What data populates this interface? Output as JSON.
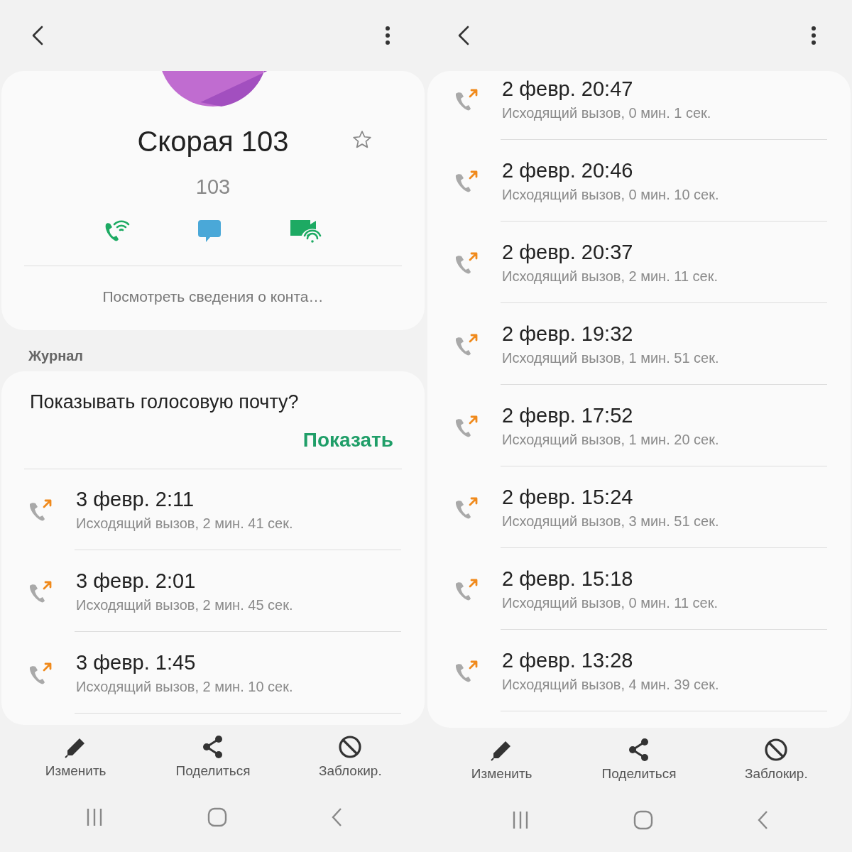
{
  "screens": [
    {
      "kind": "contact",
      "contact": {
        "name": "Скорая 103",
        "number": "103",
        "favorite": false,
        "quick_actions": [
          {
            "kind": "wifi-call"
          },
          {
            "kind": "message"
          },
          {
            "kind": "video-call"
          }
        ],
        "details_link": "Посмотреть сведения о конта…"
      },
      "section_label": "Журнал",
      "voicemail": {
        "question": "Показывать голосовую почту?",
        "button": "Показать"
      },
      "calls": [
        {
          "date": "3 февр. 2:11",
          "detail": "Исходящий вызов, 2 мин. 41 сек."
        },
        {
          "date": "3 февр. 2:01",
          "detail": "Исходящий вызов, 2 мин. 45 сек."
        },
        {
          "date": "3 февр. 1:45",
          "detail": "Исходящий вызов, 2 мин. 10 сек."
        }
      ],
      "actions": [
        {
          "kind": "edit",
          "label": "Изменить"
        },
        {
          "kind": "share",
          "label": "Поделиться"
        },
        {
          "kind": "block",
          "label": "Заблокир."
        }
      ]
    },
    {
      "kind": "history",
      "calls": [
        {
          "date": "2 февр. 20:47",
          "detail": "Исходящий вызов, 0 мин. 1 сек."
        },
        {
          "date": "2 февр. 20:46",
          "detail": "Исходящий вызов, 0 мин. 10 сек."
        },
        {
          "date": "2 февр. 20:37",
          "detail": "Исходящий вызов, 2 мин. 11 сек."
        },
        {
          "date": "2 февр. 19:32",
          "detail": "Исходящий вызов, 1 мин. 51 сек."
        },
        {
          "date": "2 февр. 17:52",
          "detail": "Исходящий вызов, 1 мин. 20 сек."
        },
        {
          "date": "2 февр. 15:24",
          "detail": "Исходящий вызов, 3 мин. 51 сек."
        },
        {
          "date": "2 февр. 15:18",
          "detail": "Исходящий вызов, 0 мин. 11 сек."
        },
        {
          "date": "2 февр. 13:28",
          "detail": "Исходящий вызов, 4 мин. 39 сек."
        }
      ],
      "actions": [
        {
          "kind": "edit",
          "label": "Изменить"
        },
        {
          "kind": "share",
          "label": "Поделиться"
        },
        {
          "kind": "block",
          "label": "Заблокир."
        }
      ]
    }
  ]
}
